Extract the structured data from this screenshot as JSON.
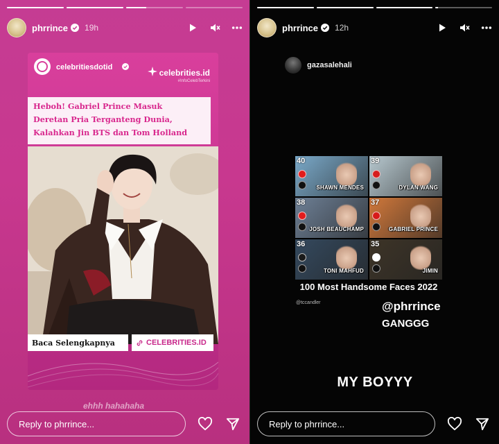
{
  "left_story": {
    "progress": [
      1.0,
      1.0,
      0.35,
      0.0
    ],
    "username": "phrrince",
    "time": "19h",
    "card": {
      "handle": "celebritiesdotid",
      "brand": "celebrities.id",
      "brand_tag": "#InfoCelebTerkini",
      "headline_lines": [
        "Heboh! Gabriel Prince Masuk",
        "Deretan Pria Terganteng Dunia,",
        "Kalahkan Jin BTS dan Tom Holland"
      ],
      "cta_left": "Baca Selengkapnya",
      "cta_right": "CELEBRITIES.ID"
    },
    "caption": "ehhh hahahaha",
    "reply_placeholder": "Reply to phrrince..."
  },
  "right_story": {
    "progress": [
      1.0,
      1.0,
      1.0,
      0.05
    ],
    "username": "phrrince",
    "time": "12h",
    "mention_username": "gazasalehali",
    "grid_cells": [
      {
        "rank": "40",
        "name": "SHAWN MENDES",
        "bg": "#7aa9c9",
        "flag": "#e21c1c"
      },
      {
        "rank": "39",
        "name": "DYLAN WANG",
        "bg": "#b7c8cf",
        "flag": "#d61e1e"
      },
      {
        "rank": "38",
        "name": "JOSH BEAUCHAMP",
        "bg": "#6d7f95",
        "flag": "#e21c1c"
      },
      {
        "rank": "37",
        "name": "GABRIEL PRINCE",
        "bg": "#d0783b",
        "flag": "#d71a1a"
      },
      {
        "rank": "36",
        "name": "TONI MAHFUD",
        "bg": "#34495e",
        "flag": "#1a1a1a"
      },
      {
        "rank": "35",
        "name": "JIMIN",
        "bg": "#3d3427",
        "flag": "#ffffff"
      }
    ],
    "title": "100 Most Handsome Faces 2022",
    "credit": "@tccandler",
    "mention_text": "@phrrince",
    "gang_text": "GANGGG",
    "myboy_text": "MY BOYYY",
    "reply_placeholder": "Reply to phrrince..."
  },
  "icons": {
    "play": "play-icon",
    "mute": "mute-icon",
    "more": "more-icon",
    "heart": "heart-icon",
    "send": "send-icon",
    "verified": "verified-icon"
  }
}
